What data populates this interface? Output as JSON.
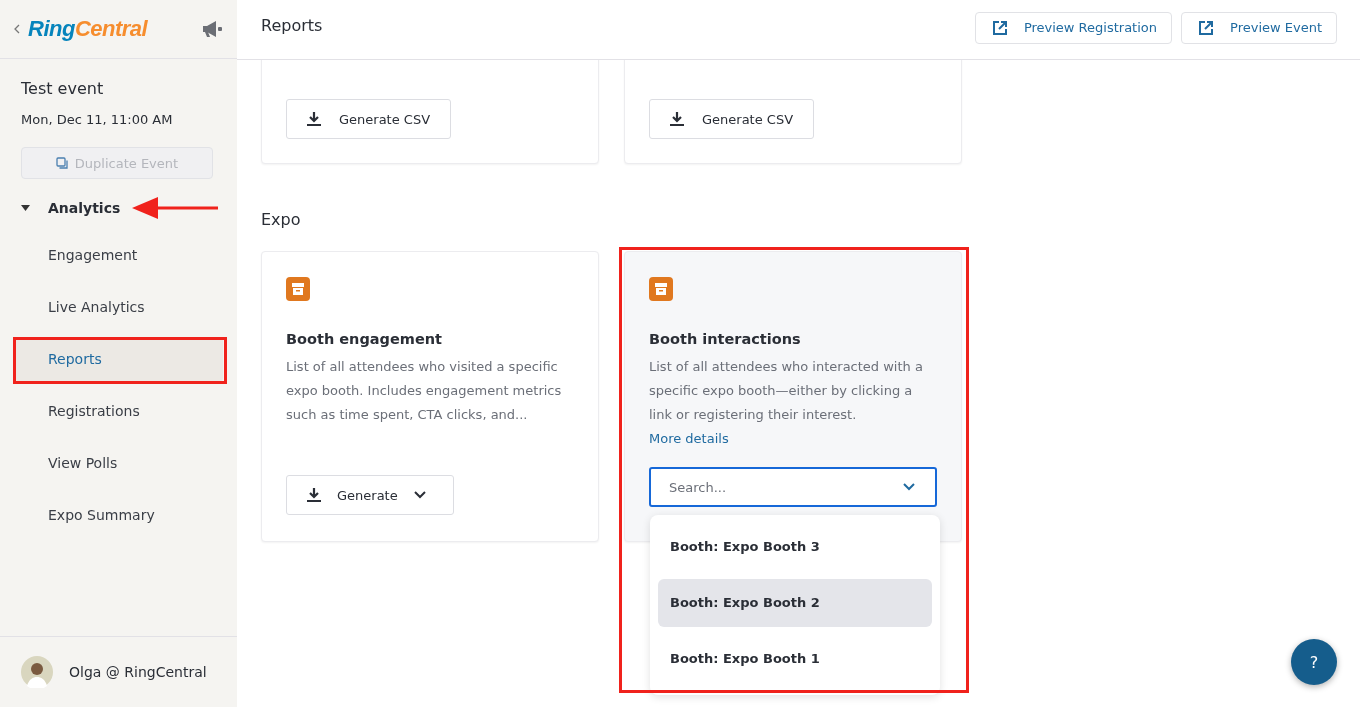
{
  "logo": {
    "part1": "Ring",
    "part2": "Central"
  },
  "event": {
    "title": "Test event",
    "date": "Mon, Dec 11, 11:00 AM",
    "duplicate_button": {
      "label": "Duplicate Event",
      "disabled": true
    }
  },
  "nav": {
    "section": {
      "label": "Analytics",
      "expanded": true,
      "arrow_annotation": true
    },
    "items": [
      {
        "label": "Engagement",
        "selected": false,
        "annotated": false
      },
      {
        "label": "Live Analytics",
        "selected": false,
        "annotated": false
      },
      {
        "label": "Reports",
        "selected": true,
        "annotated": true
      },
      {
        "label": "Registrations",
        "selected": false,
        "annotated": false
      },
      {
        "label": "View Polls",
        "selected": false,
        "annotated": false
      },
      {
        "label": "Expo Summary",
        "selected": false,
        "annotated": false
      }
    ]
  },
  "user": {
    "name": "Olga @ RingCentral"
  },
  "header": {
    "title": "Reports",
    "buttons": [
      "Preview Registration",
      "Preview Event"
    ]
  },
  "top_cards": [
    {
      "button": "Generate CSV"
    },
    {
      "button": "Generate CSV"
    }
  ],
  "section": {
    "title": "Expo"
  },
  "cards": [
    {
      "title": "Booth engagement",
      "description": "List of all attendees who visited a specific expo booth. Includes engagement metrics such as time spent, CTA clicks, and...",
      "kind": "generate",
      "button": "Generate"
    },
    {
      "title": "Booth interactions",
      "description": "List of all attendees who interacted with a specific expo booth—either by clicking a link or registering their interest.",
      "link": "More details",
      "kind": "search",
      "placeholder": "Search...",
      "annotated": true,
      "options": [
        {
          "label": "Booth: Expo Booth 3",
          "selected": false
        },
        {
          "label": "Booth: Expo Booth 2",
          "selected": true
        },
        {
          "label": "Booth: Expo Booth 1",
          "selected": false
        }
      ]
    }
  ],
  "help_button": "?"
}
